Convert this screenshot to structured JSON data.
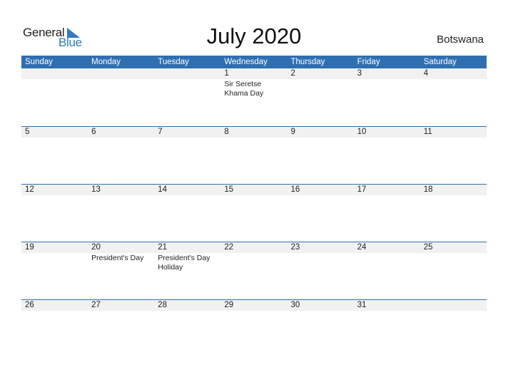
{
  "logo": {
    "line1": "General",
    "line2": "Blue"
  },
  "title": "July 2020",
  "country": "Botswana",
  "colors": {
    "accent": "#2e6fb1",
    "logo_blue": "#2e7bc6",
    "date_row_bg": "#f1f1f1"
  },
  "weekdays": [
    "Sunday",
    "Monday",
    "Tuesday",
    "Wednesday",
    "Thursday",
    "Friday",
    "Saturday"
  ],
  "weeks": [
    {
      "days": [
        "",
        "",
        "",
        "1",
        "2",
        "3",
        "4"
      ],
      "events": [
        "",
        "",
        "",
        "Sir Seretse Khama Day",
        "",
        "",
        ""
      ]
    },
    {
      "days": [
        "5",
        "6",
        "7",
        "8",
        "9",
        "10",
        "11"
      ],
      "events": [
        "",
        "",
        "",
        "",
        "",
        "",
        ""
      ]
    },
    {
      "days": [
        "12",
        "13",
        "14",
        "15",
        "16",
        "17",
        "18"
      ],
      "events": [
        "",
        "",
        "",
        "",
        "",
        "",
        ""
      ]
    },
    {
      "days": [
        "19",
        "20",
        "21",
        "22",
        "23",
        "24",
        "25"
      ],
      "events": [
        "",
        "President's Day",
        "President's Day Holiday",
        "",
        "",
        "",
        ""
      ]
    },
    {
      "days": [
        "26",
        "27",
        "28",
        "29",
        "30",
        "31",
        ""
      ],
      "events": [
        "",
        "",
        "",
        "",
        "",
        "",
        ""
      ]
    }
  ]
}
